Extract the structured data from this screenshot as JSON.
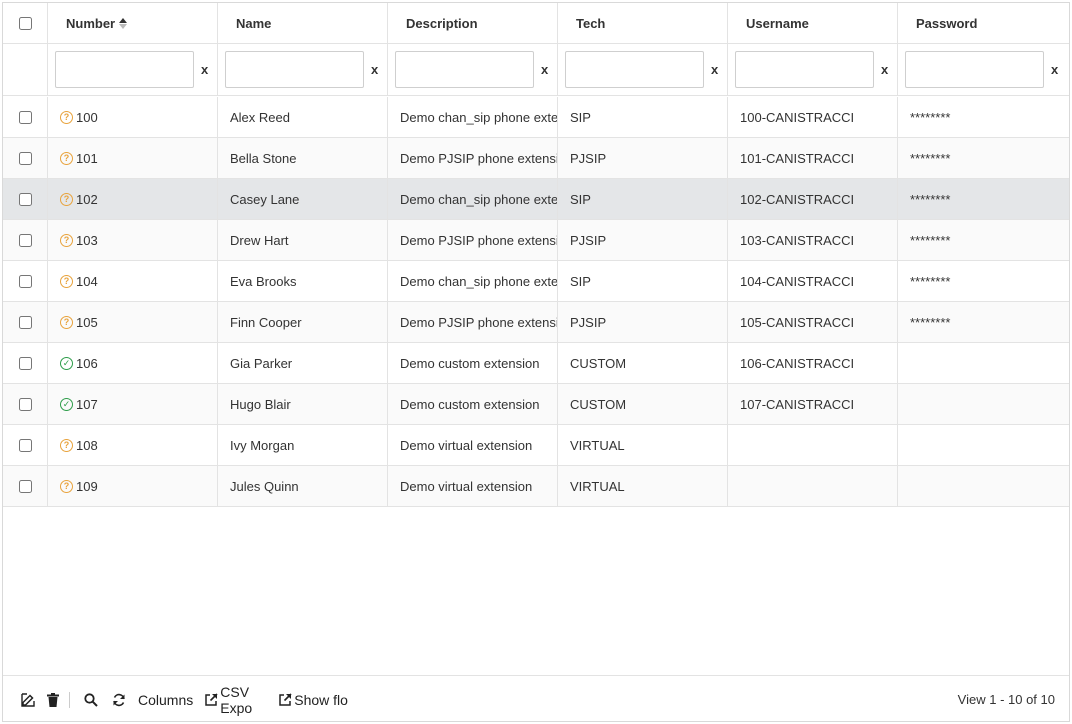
{
  "columns": {
    "number": "Number",
    "name": "Name",
    "description": "Description",
    "tech": "Tech",
    "username": "Username",
    "password": "Password"
  },
  "filter": {
    "clear": "x"
  },
  "rows": [
    {
      "number": "100",
      "status": "unknown",
      "name": "Alex Reed",
      "description": "Demo chan_sip phone extension",
      "tech": "SIP",
      "username": "100-CANISTRACCI",
      "password": "********"
    },
    {
      "number": "101",
      "status": "unknown",
      "name": "Bella Stone",
      "description": "Demo PJSIP phone extension",
      "tech": "PJSIP",
      "username": "101-CANISTRACCI",
      "password": "********"
    },
    {
      "number": "102",
      "status": "unknown",
      "name": "Casey Lane",
      "description": "Demo chan_sip phone extension",
      "tech": "SIP",
      "username": "102-CANISTRACCI",
      "password": "********"
    },
    {
      "number": "103",
      "status": "unknown",
      "name": "Drew Hart",
      "description": "Demo PJSIP phone extension",
      "tech": "PJSIP",
      "username": "103-CANISTRACCI",
      "password": "********"
    },
    {
      "number": "104",
      "status": "unknown",
      "name": "Eva Brooks",
      "description": "Demo chan_sip phone extension",
      "tech": "SIP",
      "username": "104-CANISTRACCI",
      "password": "********"
    },
    {
      "number": "105",
      "status": "unknown",
      "name": "Finn Cooper",
      "description": "Demo PJSIP phone extension",
      "tech": "PJSIP",
      "username": "105-CANISTRACCI",
      "password": "********"
    },
    {
      "number": "106",
      "status": "ok",
      "name": "Gia Parker",
      "description": "Demo custom extension",
      "tech": "CUSTOM",
      "username": "106-CANISTRACCI",
      "password": ""
    },
    {
      "number": "107",
      "status": "ok",
      "name": "Hugo Blair",
      "description": "Demo custom extension",
      "tech": "CUSTOM",
      "username": "107-CANISTRACCI",
      "password": ""
    },
    {
      "number": "108",
      "status": "unknown",
      "name": "Ivy Morgan",
      "description": "Demo virtual extension",
      "tech": "VIRTUAL",
      "username": "",
      "password": ""
    },
    {
      "number": "109",
      "status": "unknown",
      "name": "Jules Quinn",
      "description": "Demo virtual extension",
      "tech": "VIRTUAL",
      "username": "",
      "password": ""
    }
  ],
  "toolbar": {
    "edit_icon": "edit-icon",
    "delete_icon": "trash-icon",
    "search_icon": "search-icon",
    "refresh_icon": "refresh-icon",
    "columns_label": "Columns",
    "csv_label": "CSV Expo",
    "float_label": "Show flo"
  },
  "pager": {
    "info": "View 1 - 10 of 10"
  },
  "colors": {
    "unknown": "#e8a33d",
    "ok": "#2e9d4a",
    "highlight_row": "#e4e6e8"
  }
}
